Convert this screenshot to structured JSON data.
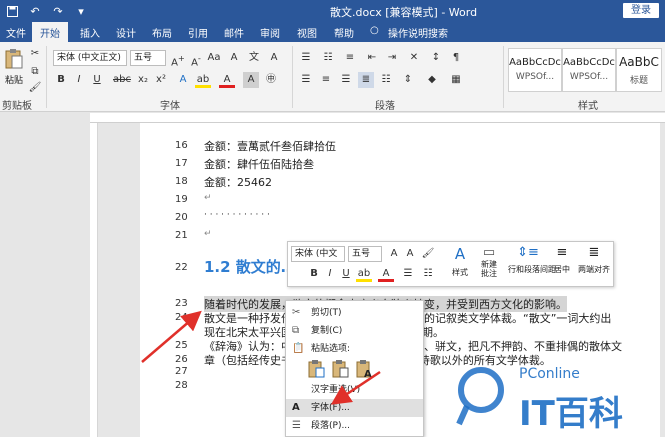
{
  "window": {
    "title": "散文.docx [兼容模式] - Word",
    "login_label": "登录",
    "accent": "#2b579a"
  },
  "qat": {
    "save_icon": "save-icon",
    "undo_icon": "undo-icon",
    "redo_icon": "redo-icon"
  },
  "tabs": [
    "文件",
    "开始",
    "插入",
    "设计",
    "布局",
    "引用",
    "邮件",
    "审阅",
    "视图",
    "帮助",
    "操作说明搜索"
  ],
  "ribbon": {
    "paste_label": "粘贴",
    "clipboard_label": "剪贴板",
    "font_label": "字体",
    "paragraph_label": "段落",
    "styles_label": "样式",
    "font_name": "宋体 (中文正文)",
    "font_size": "五号",
    "styles": [
      {
        "preview": "AaBbCcDc",
        "name": "WPSOf..."
      },
      {
        "preview": "AaBbCcDc",
        "name": "WPSOf..."
      },
      {
        "preview": "AaBbC",
        "name": "标题"
      }
    ]
  },
  "document": {
    "lines": [
      {
        "num": "16",
        "text": "金额：壹萬贰仟叁佰肆拾伍"
      },
      {
        "num": "17",
        "text": "金额：肆仟伍佰陆拾叁"
      },
      {
        "num": "18",
        "text": "金额：25462"
      },
      {
        "num": "19",
        "text": ""
      },
      {
        "num": "20",
        "text": "· · · · · · · · · · · ·"
      },
      {
        "num": "21",
        "text": ""
      },
      {
        "num": "22",
        "text": ""
      },
      {
        "num": "23",
        "text": "随着时代的发展，散文的概念由广义向狭义转变，并受到西方文化的影响。"
      },
      {
        "num": "24",
        "text": "散文是一种抒发作者真情实感、写作方式灵活的记叙类文学体裁。“散文”一词大约出"
      },
      {
        "num": "",
        "text": "现在北宋太平兴国年间（976年—984年）时期。"
      },
      {
        "num": "25",
        "text": "《辞海》认为：中国六朝以来，为区别于韵文、骈文，把凡不押韵、不重排偶的散体文"
      },
      {
        "num": "26",
        "text": "章（包括经传史书），统称“散文”。后又泛指诗歌以外的所有文学体裁。"
      },
      {
        "num": "27",
        "text": ""
      },
      {
        "num": "28",
        "text": ""
      }
    ],
    "heading": "1.2 散文的…"
  },
  "minibar": {
    "font_name": "宋体 (中文",
    "font_size": "五号",
    "style_label": "样式",
    "new_comment_label": "新建批注",
    "line_spacing_label": "行和段落间距",
    "center_label": "居中",
    "justify_label": "两端对齐"
  },
  "context_menu": {
    "items": [
      {
        "label": "剪切(T)",
        "icon": "scissors-icon"
      },
      {
        "label": "复制(C)",
        "icon": "copy-icon"
      },
      {
        "label": "粘贴选项:",
        "icon": "paste-icon"
      },
      {
        "label": "汉字重选(V)",
        "icon": ""
      },
      {
        "label": "字体(F)...",
        "icon": "font-a-icon"
      },
      {
        "label": "段落(P)...",
        "icon": "paragraph-icon"
      }
    ]
  },
  "watermark": {
    "brand": "PConline",
    "name": "IT百科"
  }
}
